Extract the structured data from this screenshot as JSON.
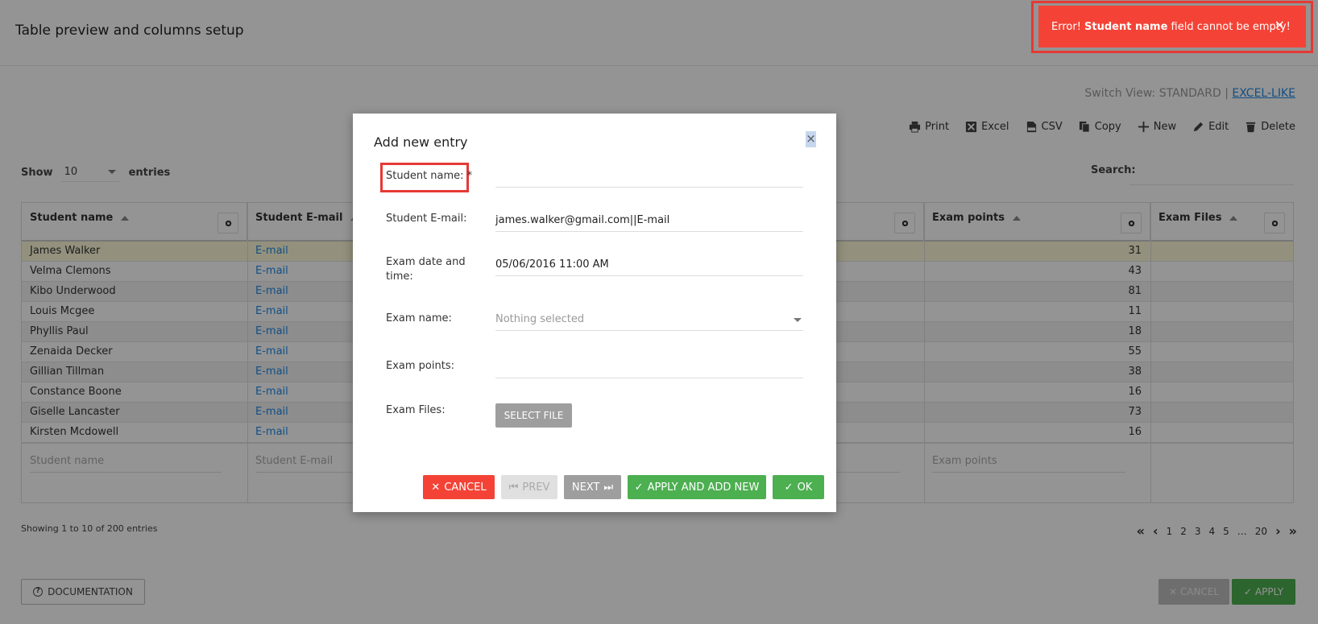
{
  "header": {
    "title": "Table preview and columns setup"
  },
  "switch_view": {
    "label": "Switch View:",
    "standard": "STANDARD",
    "separator": "|",
    "excel_like": "EXCEL-LIKE"
  },
  "toolbar": {
    "print": "Print",
    "excel": "Excel",
    "csv": "CSV",
    "copy": "Copy",
    "new": "New",
    "edit": "Edit",
    "delete": "Delete"
  },
  "length": {
    "show": "Show",
    "value": "10",
    "entries": "entries"
  },
  "search": {
    "label": "Search:"
  },
  "columns": {
    "student_name": "Student name",
    "student_email": "Student E-mail",
    "exam_points": "Exam points",
    "exam_files": "Exam Files"
  },
  "rows": [
    {
      "name": "James Walker",
      "email": "E-mail",
      "points": "31"
    },
    {
      "name": "Velma Clemons",
      "email": "E-mail",
      "points": "43"
    },
    {
      "name": "Kibo Underwood",
      "email": "E-mail",
      "points": "81"
    },
    {
      "name": "Louis Mcgee",
      "email": "E-mail",
      "points": "11"
    },
    {
      "name": "Phyllis Paul",
      "email": "E-mail",
      "points": "18"
    },
    {
      "name": "Zenaida Decker",
      "email": "E-mail",
      "points": "55"
    },
    {
      "name": "Gillian Tillman",
      "email": "E-mail",
      "points": "38"
    },
    {
      "name": "Constance Boone",
      "email": "E-mail",
      "points": "16"
    },
    {
      "name": "Giselle Lancaster",
      "email": "E-mail",
      "points": "73"
    },
    {
      "name": "Kirsten Mcdowell",
      "email": "E-mail",
      "points": "16"
    }
  ],
  "filters": {
    "student_name": "Student name",
    "student_email": "Student E-mail",
    "exam_points": "Exam points"
  },
  "info": "Showing 1 to 10 of 200 entries",
  "pagination": {
    "pages": [
      "1",
      "2",
      "3",
      "4",
      "5"
    ],
    "ellipsis": "…",
    "last": "20"
  },
  "footer": {
    "documentation": "DOCUMENTATION",
    "cancel": "CANCEL",
    "apply": "APPLY"
  },
  "modal": {
    "title": "Add new entry",
    "close": "×",
    "fields": {
      "student_name_label": "Student name: *",
      "student_name_value": "",
      "student_email_label": "Student E-mail:",
      "student_email_value": "james.walker@gmail.com||E-mail",
      "exam_date_label": "Exam date and time:",
      "exam_date_value": "05/06/2016 11:00 AM",
      "exam_name_label": "Exam name:",
      "exam_name_placeholder": "Nothing selected",
      "exam_points_label": "Exam points:",
      "exam_points_value": "",
      "exam_files_label": "Exam Files:",
      "select_file": "SELECT FILE"
    },
    "buttons": {
      "cancel": "CANCEL",
      "prev": "PREV",
      "next": "NEXT",
      "apply_add_new": "APPLY AND ADD NEW",
      "ok": "OK"
    }
  },
  "toast": {
    "prefix": "Error!",
    "field": "Student name",
    "message": "field cannot be empty!",
    "close": "×"
  },
  "colors": {
    "error": "#f44336",
    "success": "#4caf50",
    "link": "#1e88e5",
    "row_highlight": "#fdfad8"
  }
}
